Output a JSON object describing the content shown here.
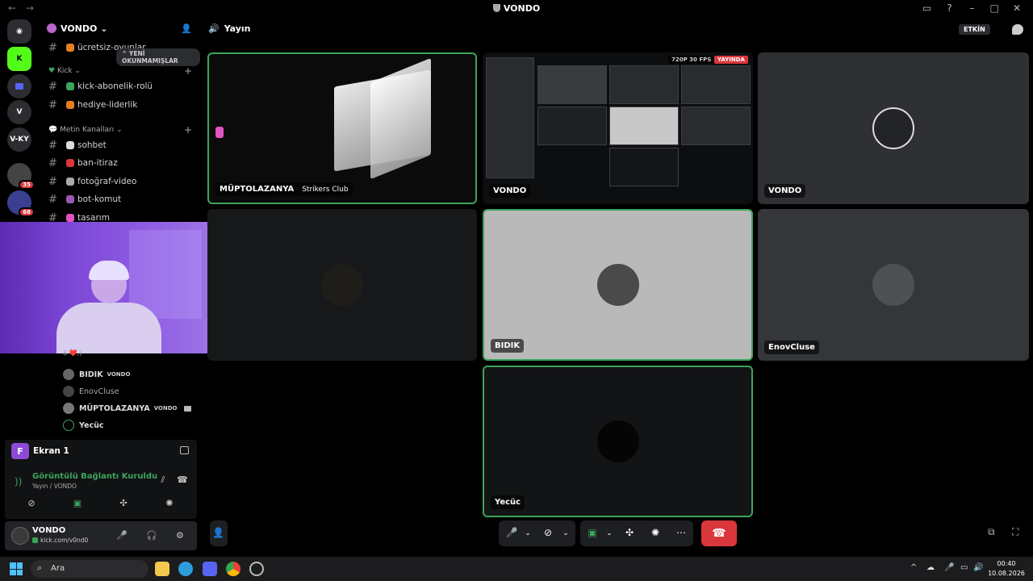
{
  "window": {
    "title": "VONDO",
    "nav_back": "←",
    "nav_forward": "→"
  },
  "guilds": {
    "direct_messages": "Direktmesaj",
    "vky_label": "V-KY",
    "badge_1": "35",
    "badge_2": "68"
  },
  "server": {
    "name": "VONDO",
    "unread_pill": "^ YENİ OKUNMAMIŞLAR",
    "partial_channel": "ücretsiz-oyunlar",
    "categories": [
      {
        "label": "Kick"
      },
      {
        "label": "Metin Kanalları"
      }
    ],
    "kick_channels": [
      {
        "name": "kick-abonelik-rolü",
        "emoji_color": "#3ba55c"
      },
      {
        "name": "hediye-liderlik",
        "emoji_color": "#e67e22"
      }
    ],
    "text_channels": [
      {
        "name": "sohbet",
        "emoji_color": "#dddddd"
      },
      {
        "name": "ban-itiraz",
        "emoji_color": "#da373c"
      },
      {
        "name": "fotoğraf-video",
        "emoji_color": "#aaaaaa"
      },
      {
        "name": "bot-komut",
        "emoji_color": "#9b59b6"
      },
      {
        "name": "tasarım",
        "emoji_color": "#e254c0"
      }
    ]
  },
  "voice_users": [
    {
      "name": "BIDIK",
      "tag": "VONDO",
      "has_camera": false
    },
    {
      "name": "EnovCluse",
      "tag": "",
      "has_camera": false
    },
    {
      "name": "MÜPTOLAZANYA",
      "tag": "VONDO",
      "has_camera": true
    },
    {
      "name": "Yecüc",
      "tag": "",
      "has_camera": false
    }
  ],
  "partial_voice_user": "8 ❤️;)",
  "screen_panel": {
    "tile_letter": "F",
    "name": "Ekran 1",
    "connection_status": "Görüntülü Bağlantı Kuruldu",
    "connection_sub": "Yayın / VONDO"
  },
  "user_panel": {
    "name": "VONDO",
    "status": "kick.com/v0nd0"
  },
  "stage": {
    "channel_name": "Yayın",
    "activity_label": "ETKİN",
    "tiles": [
      {
        "name": "MÜPTOLAZANYA",
        "club": "Strikers Club"
      },
      {
        "name": "VONDO",
        "fps": "720P 30 FPS",
        "live": "YAYINDA"
      },
      {
        "name": "VONDO"
      },
      {
        "name": ""
      },
      {
        "name": "BIDIK"
      },
      {
        "name": "EnovCluse"
      },
      {
        "name": "Yecüc"
      }
    ]
  },
  "taskbar": {
    "search_placeholder": "Ara",
    "time": "00:40",
    "date": "10.08.2026"
  },
  "colors": {
    "accent_green": "#3ba55c",
    "danger_red": "#da373c",
    "brand_purple": "#8c4ad6"
  }
}
